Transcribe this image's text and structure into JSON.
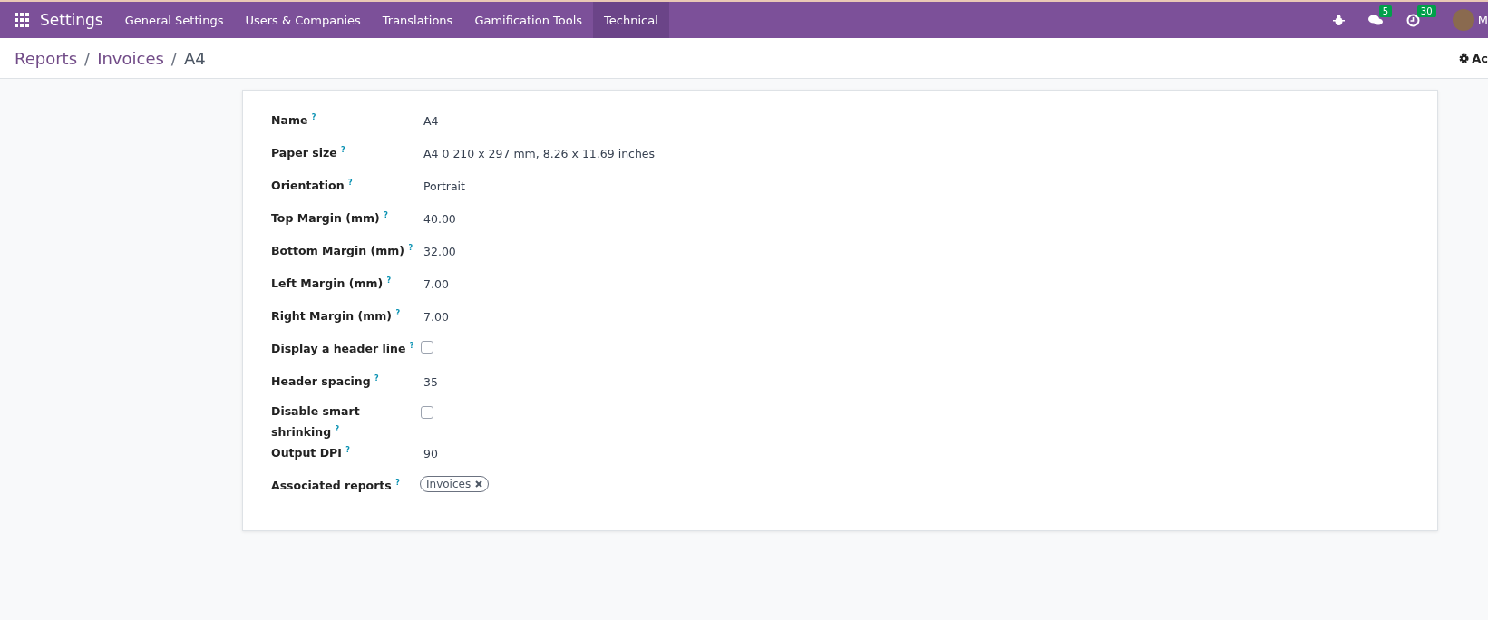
{
  "navbar": {
    "app_title": "Settings",
    "menus": [
      {
        "label": "General Settings",
        "selected": false
      },
      {
        "label": "Users & Companies",
        "selected": false
      },
      {
        "label": "Translations",
        "selected": false
      },
      {
        "label": "Gamification Tools",
        "selected": false
      },
      {
        "label": "Technical",
        "selected": true
      }
    ],
    "messages_badge": "5",
    "activities_badge": "30",
    "user_name": "M"
  },
  "breadcrumbs": [
    {
      "kind": "link",
      "text": "Reports"
    },
    {
      "kind": "separator",
      "text": "/"
    },
    {
      "kind": "link",
      "text": "Invoices"
    },
    {
      "kind": "separator",
      "text": "/"
    },
    {
      "kind": "current",
      "text": "A4"
    }
  ],
  "action_label": "Ac",
  "form": {
    "fields": [
      {
        "kind": "text",
        "label": "Name",
        "help": "?",
        "value": "A4"
      },
      {
        "kind": "text",
        "label": "Paper size",
        "help": "?",
        "value": "A4 0 210 x 297 mm, 8.26 x 11.69 inches"
      },
      {
        "kind": "text",
        "label": "Orientation",
        "help": "?",
        "value": "Portrait"
      },
      {
        "kind": "text",
        "label": "Top Margin (mm)",
        "help": "?",
        "value": "40.00"
      },
      {
        "kind": "text",
        "label": "Bottom Margin (mm)",
        "help": "?",
        "value": "32.00"
      },
      {
        "kind": "text",
        "label": "Left Margin (mm)",
        "help": "?",
        "value": "7.00"
      },
      {
        "kind": "text",
        "label": "Right Margin (mm)",
        "help": "?",
        "value": "7.00"
      },
      {
        "kind": "checkbox",
        "label": "Display a header line",
        "help": "?",
        "checked": false
      },
      {
        "kind": "text",
        "label": "Header spacing",
        "help": "?",
        "value": "35"
      },
      {
        "kind": "checkbox",
        "label": "Disable smart shrinking",
        "help": "?",
        "checked": false
      },
      {
        "kind": "text",
        "label": "Output DPI",
        "help": "?",
        "value": "90"
      },
      {
        "kind": "tags",
        "label": "Associated reports",
        "help": "?",
        "tags": [
          "Invoices"
        ]
      }
    ]
  }
}
